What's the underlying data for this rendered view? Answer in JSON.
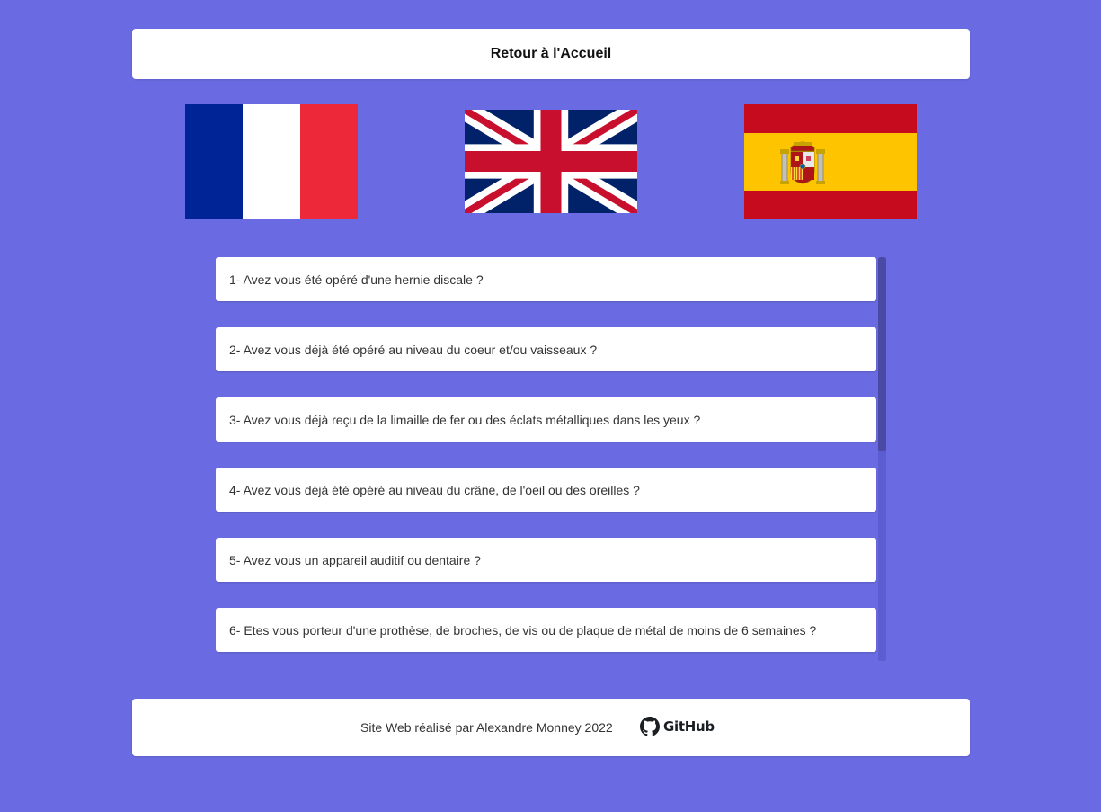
{
  "header": {
    "home_label": "Retour à l'Accueil"
  },
  "languages": [
    {
      "name": "fr-flag-icon"
    },
    {
      "name": "uk-flag-icon"
    },
    {
      "name": "es-flag-icon"
    }
  ],
  "questions": [
    "1- Avez vous été opéré d'une hernie discale ?",
    "2- Avez vous déjà été opéré au niveau du coeur et/ou vaisseaux ?",
    "3- Avez vous déjà reçu de la limaille de fer ou des éclats métalliques dans les yeux ?",
    "4- Avez vous déjà été opéré au niveau du crâne, de l'oeil ou des oreilles ?",
    "5- Avez vous un appareil auditif ou dentaire ?",
    "6- Etes vous porteur d'une prothèse, de broches, de vis ou de plaque de métal de moins de 6 semaines ?"
  ],
  "footer": {
    "credit": "Site Web réalisé par Alexandre Monney 2022",
    "github_label": "GitHub"
  },
  "colors": {
    "background": "#6a6be2",
    "card": "#ffffff",
    "scrollbar_thumb": "#4a4aa6"
  }
}
